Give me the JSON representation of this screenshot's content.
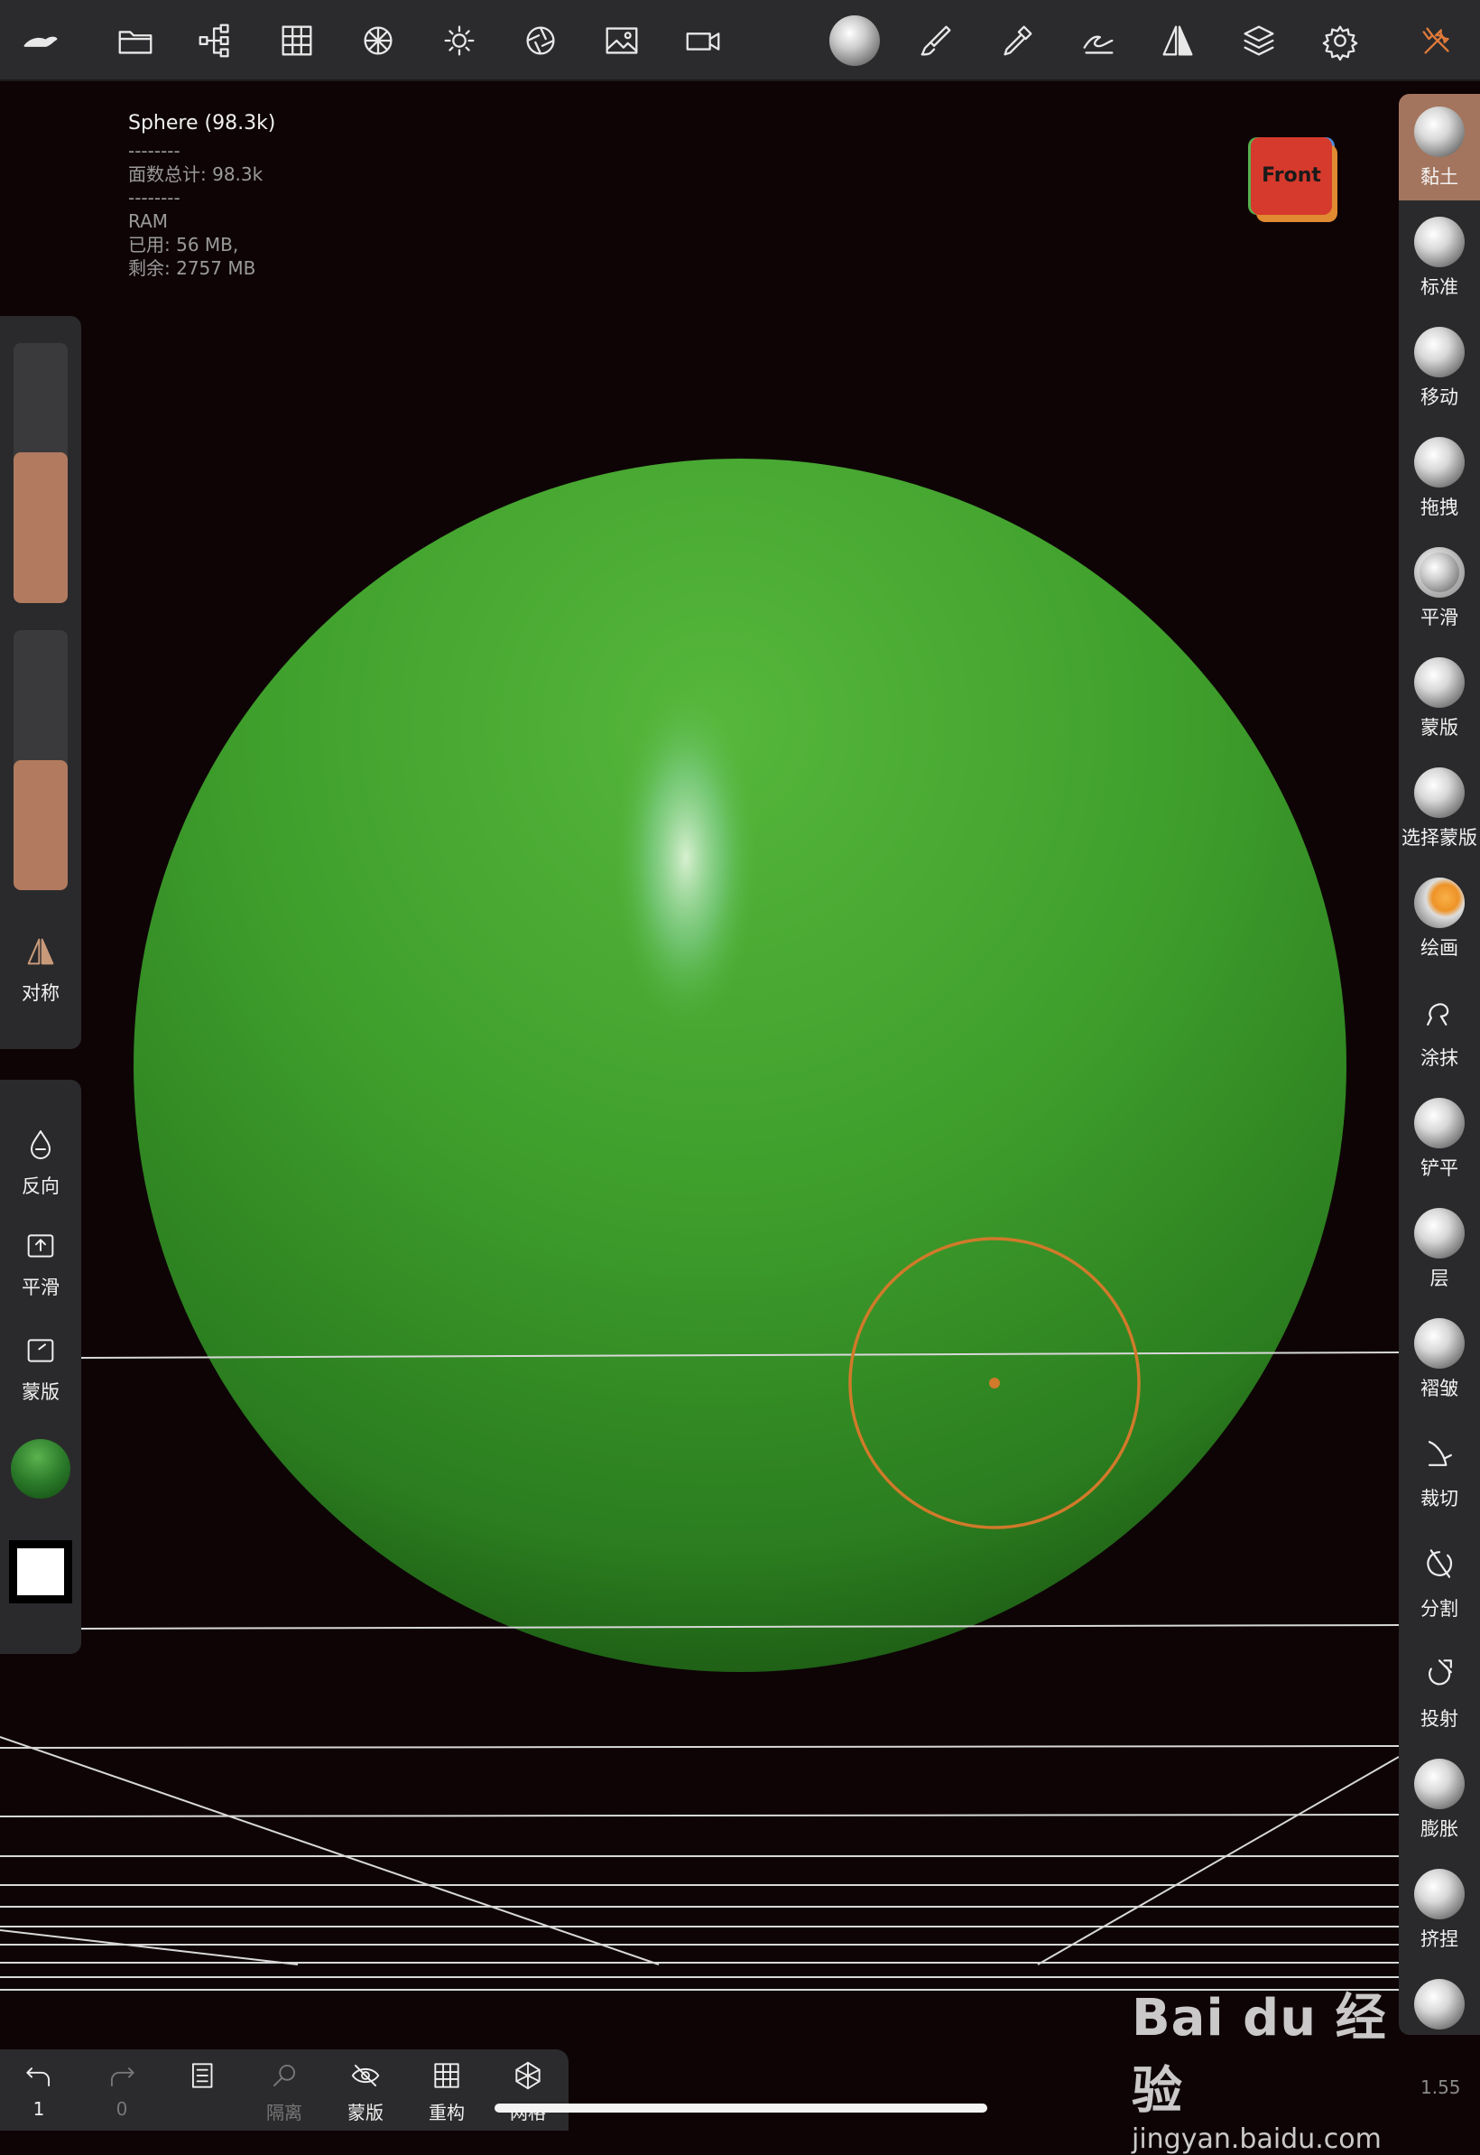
{
  "toolbar": {
    "icons": [
      "app-logo-icon",
      "folder-icon",
      "scene-tree-icon",
      "grid-icon",
      "mesh-icon",
      "light-icon",
      "aperture-icon",
      "image-icon",
      "video-icon",
      "matcap-icon",
      "brush-icon",
      "pipette-icon",
      "stroke-icon",
      "symmetry-icon",
      "layers-icon",
      "settings-icon",
      "tools-icon"
    ]
  },
  "stats": {
    "title": "Sphere (98.3k)",
    "sep1": "--------",
    "faces": "面数总计:  98.3k",
    "sep2": "--------",
    "ram": "RAM",
    "used": "已用:  56 MB,",
    "free": "剩余:  2757 MB"
  },
  "viewcube": {
    "label": "Front"
  },
  "tools": [
    {
      "label": "黏土",
      "active": true
    },
    {
      "label": "标准"
    },
    {
      "label": "移动"
    },
    {
      "label": "拖拽"
    },
    {
      "label": "平滑"
    },
    {
      "label": "蒙版"
    },
    {
      "label": "选择蒙版"
    },
    {
      "label": "绘画"
    },
    {
      "label": "涂抹"
    },
    {
      "label": "铲平"
    },
    {
      "label": "层"
    },
    {
      "label": "褶皱"
    },
    {
      "label": "裁切"
    },
    {
      "label": "分割"
    },
    {
      "label": "投射"
    },
    {
      "label": "膨胀"
    },
    {
      "label": "挤捏"
    }
  ],
  "left": {
    "radius_level": 0.58,
    "intensity_level": 0.5,
    "symmetry": "对称",
    "invert": "反向",
    "smooth": "平滑",
    "mask": "蒙版"
  },
  "bottom": {
    "undo_count": "1",
    "redo_count": "0",
    "isolate": "隔离",
    "mask": "蒙版",
    "remesh": "重构",
    "voxel": "网格"
  },
  "version": "1.55",
  "watermark": {
    "logo": "Bai du 经验",
    "url": "jingyan.baidu.com"
  },
  "colors": {
    "sphere": "#3fa12f",
    "brush_ring": "#d07a2a",
    "accent": "#a4755e"
  }
}
